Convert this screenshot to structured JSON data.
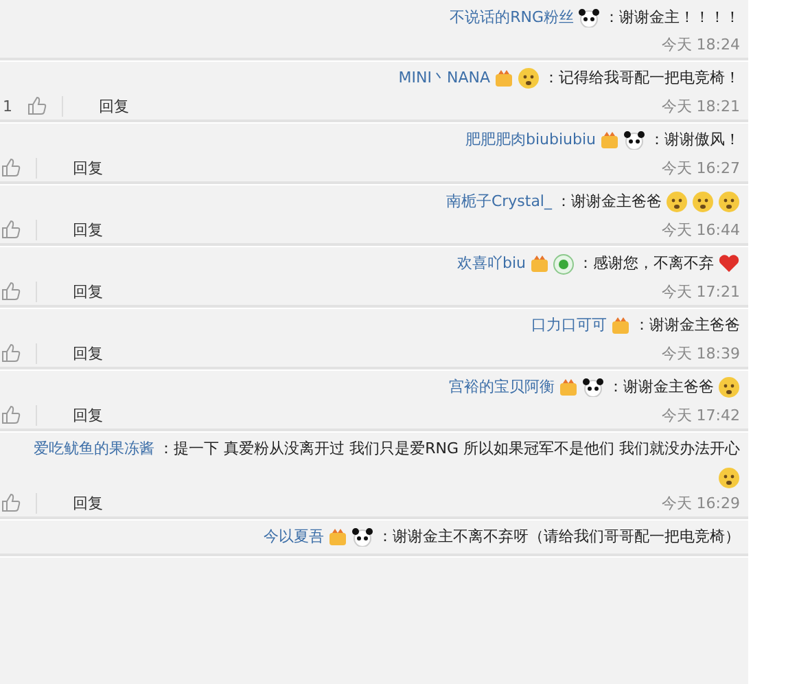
{
  "comments": [
    {
      "user": "不说话的RNG粉丝",
      "text": "：谢谢金主！！！！",
      "time": "今天 18:24"
    },
    {
      "user": "MINI丶NANA",
      "text": "：记得给我哥配一把电竞椅！",
      "time": "今天 18:21",
      "reply": "回复",
      "like_count": "1"
    },
    {
      "user": "肥肥肥肉biubiubiu",
      "text": "：谢谢傲风！",
      "time": "今天 16:27",
      "reply": "回复"
    },
    {
      "user": "南栀子Crystal_",
      "text": "：谢谢金主爸爸",
      "time": "今天 16:44",
      "reply": "回复"
    },
    {
      "user": "欢喜吖biu",
      "text": "：感谢您，不离不弃",
      "time": "今天 17:21",
      "reply": "回复"
    },
    {
      "user": "口力口可可",
      "text": "：谢谢金主爸爸",
      "time": "今天 18:39",
      "reply": "回复"
    },
    {
      "user": "宫裕的宝贝阿衡",
      "text": "：谢谢金主爸爸",
      "time": "今天 17:42",
      "reply": "回复"
    },
    {
      "user": "爱吃鱿鱼的果冻酱",
      "text": "：提一下 真爱粉从没离开过 我们只是爱RNG 所以如果冠军不是他们 我们就没办法开心",
      "time": "今天 16:29",
      "reply": "回复"
    },
    {
      "user": "今以夏吾",
      "text": "：谢谢金主不离不弃呀（请给我们哥哥配一把电竞椅）"
    }
  ]
}
